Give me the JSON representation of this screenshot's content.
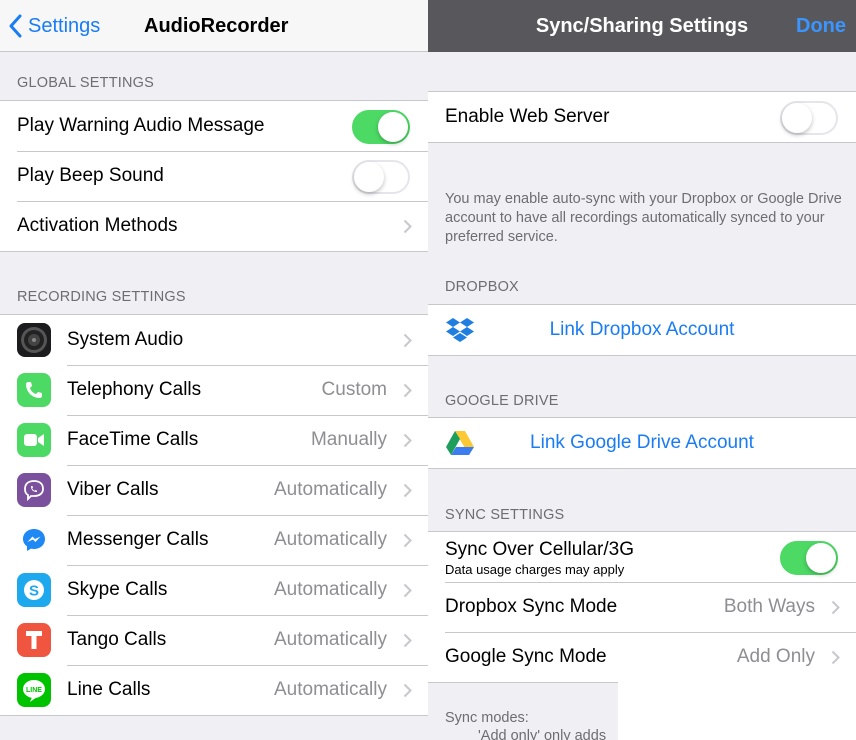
{
  "left": {
    "nav": {
      "back_label": "Settings",
      "title": "AudioRecorder"
    },
    "global_header": "GLOBAL SETTINGS",
    "global_items": [
      {
        "label": "Play Warning Audio Message",
        "toggle": true
      },
      {
        "label": "Play Beep Sound",
        "toggle": false
      },
      {
        "label": "Activation Methods"
      }
    ],
    "recording_header": "RECORDING SETTINGS",
    "recording_items": [
      {
        "label": "System Audio",
        "value": "",
        "icon": "speaker-icon"
      },
      {
        "label": "Telephony Calls",
        "value": "Custom",
        "icon": "phone-icon"
      },
      {
        "label": "FaceTime Calls",
        "value": "Manually",
        "icon": "facetime-icon"
      },
      {
        "label": "Viber Calls",
        "value": "Automatically",
        "icon": "viber-icon"
      },
      {
        "label": "Messenger Calls",
        "value": "Automatically",
        "icon": "messenger-icon"
      },
      {
        "label": "Skype Calls",
        "value": "Automatically",
        "icon": "skype-icon"
      },
      {
        "label": "Tango Calls",
        "value": "Automatically",
        "icon": "tango-icon"
      },
      {
        "label": "Line Calls",
        "value": "Automatically",
        "icon": "line-icon"
      }
    ]
  },
  "right": {
    "nav": {
      "title": "Sync/Sharing Settings",
      "done_label": "Done"
    },
    "web_server": {
      "label": "Enable Web Server",
      "toggle": false
    },
    "note": "You may enable auto-sync with your Dropbox or Google Drive account to have all recordings automatically synced to your preferred service.",
    "dropbox_header": "DROPBOX",
    "dropbox_link": "Link Dropbox Account",
    "gdrive_header": "GOOGLE DRIVE",
    "gdrive_link": "Link Google Drive Account",
    "sync_header": "SYNC SETTINGS",
    "cellular": {
      "label": "Sync Over Cellular/3G",
      "sublabel": "Data usage charges may apply",
      "toggle": true
    },
    "dropbox_mode": {
      "label": "Dropbox Sync Mode",
      "value": "Both Ways"
    },
    "google_mode": {
      "label": "Google Sync Mode",
      "value": "Add Only"
    },
    "footer_line1": "Sync modes:",
    "footer_line2": "'Add only' only adds"
  },
  "colors": {
    "accent": "#1a7cf5",
    "toggle_on": "#4cd964",
    "background": "#efeff4",
    "dark_nav": "#58585c"
  }
}
